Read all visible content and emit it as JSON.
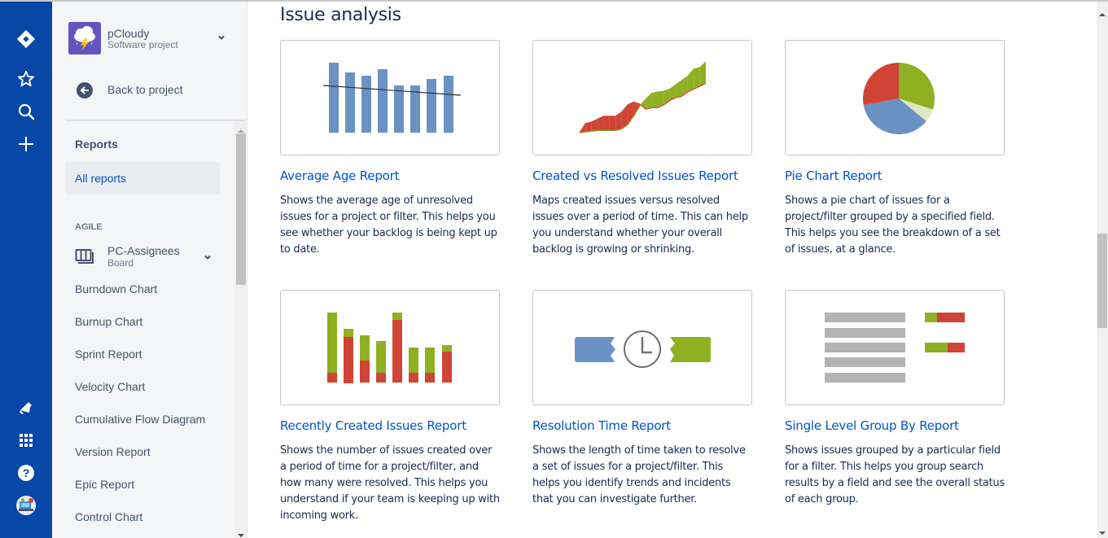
{
  "global_nav": {
    "items": [
      {
        "name": "jira-logo-icon"
      },
      {
        "name": "star-icon"
      },
      {
        "name": "search-icon"
      },
      {
        "name": "create-plus-icon"
      },
      {
        "name": "notifications-megaphone-icon"
      },
      {
        "name": "app-switcher-grid-icon"
      },
      {
        "name": "help-icon"
      },
      {
        "name": "profile-avatar"
      }
    ]
  },
  "project": {
    "name": "pCloudy",
    "type": "Software project",
    "back_label": "Back to project"
  },
  "sidebar": {
    "reports_heading": "Reports",
    "all_reports_label": "All reports",
    "group_label": "AGILE",
    "board": {
      "name": "PC-Assignees",
      "type": "Board"
    },
    "items": [
      {
        "label": "Burndown Chart"
      },
      {
        "label": "Burnup Chart"
      },
      {
        "label": "Sprint Report"
      },
      {
        "label": "Velocity Chart"
      },
      {
        "label": "Cumulative Flow Diagram"
      },
      {
        "label": "Version Report"
      },
      {
        "label": "Epic Report"
      },
      {
        "label": "Control Chart"
      }
    ]
  },
  "main": {
    "section_title": "Issue analysis",
    "cards": [
      {
        "title": "Average Age Report",
        "description": "Shows the average age of unresolved issues for a project or filter. This helps you see whether your backlog is being kept up to date."
      },
      {
        "title": "Created vs Resolved Issues Report",
        "description": "Maps created issues versus resolved issues over a period of time. This can help you understand whether your overall backlog is growing or shrinking."
      },
      {
        "title": "Pie Chart Report",
        "description": "Shows a pie chart of issues for a project/filter grouped by a specified field. This helps you see the breakdown of a set of issues, at a glance."
      },
      {
        "title": "Recently Created Issues Report",
        "description": "Shows the number of issues created over a period of time for a project/filter, and how many were resolved. This helps you understand if your team is keeping up with incoming work."
      },
      {
        "title": "Resolution Time Report",
        "description": "Shows the length of time taken to resolve a set of issues for a project/filter. This helps you identify trends and incidents that you can investigate further."
      },
      {
        "title": "Single Level Group By Report",
        "description": "Shows issues grouped by a particular field for a filter. This helps you group search results by a field and see the overall status of each group."
      }
    ]
  },
  "colors": {
    "global_nav_bg": "#0747a6",
    "link": "#0052cc",
    "blue": "#6a93c4",
    "green": "#8fb023",
    "red": "#d04437",
    "light_green": "#dde7c1",
    "gray_bar": "#b3b3b3"
  },
  "thumbnails": {
    "average_age": {
      "values": [
        86,
        74,
        70,
        78,
        58,
        58,
        66,
        70
      ],
      "trend": [
        58,
        46
      ]
    },
    "created_vs_resolved": {
      "created": [
        1,
        14,
        16,
        20,
        24,
        24,
        24,
        30,
        40,
        44,
        41,
        34,
        36,
        36,
        40,
        46,
        50,
        52,
        58,
        62,
        66,
        70
      ],
      "resolved": [
        1,
        2,
        3,
        4,
        4,
        4,
        4,
        6,
        12,
        24,
        38,
        48,
        56,
        58,
        59,
        62,
        68,
        74,
        80,
        90,
        92,
        100
      ]
    },
    "pie": {
      "slices": [
        {
          "label": "green",
          "value": 30
        },
        {
          "label": "light-green",
          "value": 6
        },
        {
          "label": "blue",
          "value": 36
        },
        {
          "label": "red",
          "value": 28
        }
      ]
    },
    "recently_created": {
      "created": [
        86,
        66,
        58,
        51,
        86,
        43,
        43,
        46
      ],
      "resolved": [
        12,
        56,
        27,
        12,
        77,
        12,
        12,
        38
      ]
    },
    "group_by": {
      "rows": 5,
      "status_bars": [
        {
          "done": 0.3,
          "todo": 0.7
        },
        {
          "done": 0.57,
          "todo": 0.43
        }
      ]
    }
  }
}
